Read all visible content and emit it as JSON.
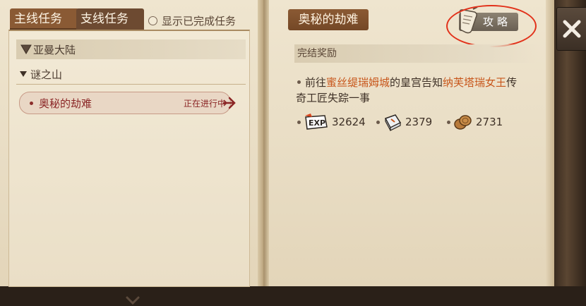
{
  "tabs": {
    "main": "主线任务",
    "side": "支线任务"
  },
  "show_completed": {
    "label": "显示已完成任务",
    "checked": false
  },
  "quest_list": {
    "region": "亚曼大陆",
    "area": "谜之山",
    "quests": [
      {
        "name": "奥秘的劫难",
        "status": "正在进行中"
      }
    ]
  },
  "detail": {
    "title": "奥秘的劫难",
    "guide_label": "攻略",
    "reward_header": "完结奖励",
    "desc": {
      "part1": "前往",
      "place": "蜜丝缇瑞姆城",
      "part2": "的皇宫告知",
      "person": "纳芙塔瑞女王",
      "part3": "传奇工匠失踪一事"
    },
    "rewards": [
      {
        "icon": "exp-icon",
        "value": "32624"
      },
      {
        "icon": "book-icon",
        "value": "2379"
      },
      {
        "icon": "coins-icon",
        "value": "2731"
      }
    ]
  },
  "colors": {
    "highlight": "#c8561b",
    "active_quest": "#8b2626",
    "annotation_ring": "#e2321b"
  }
}
